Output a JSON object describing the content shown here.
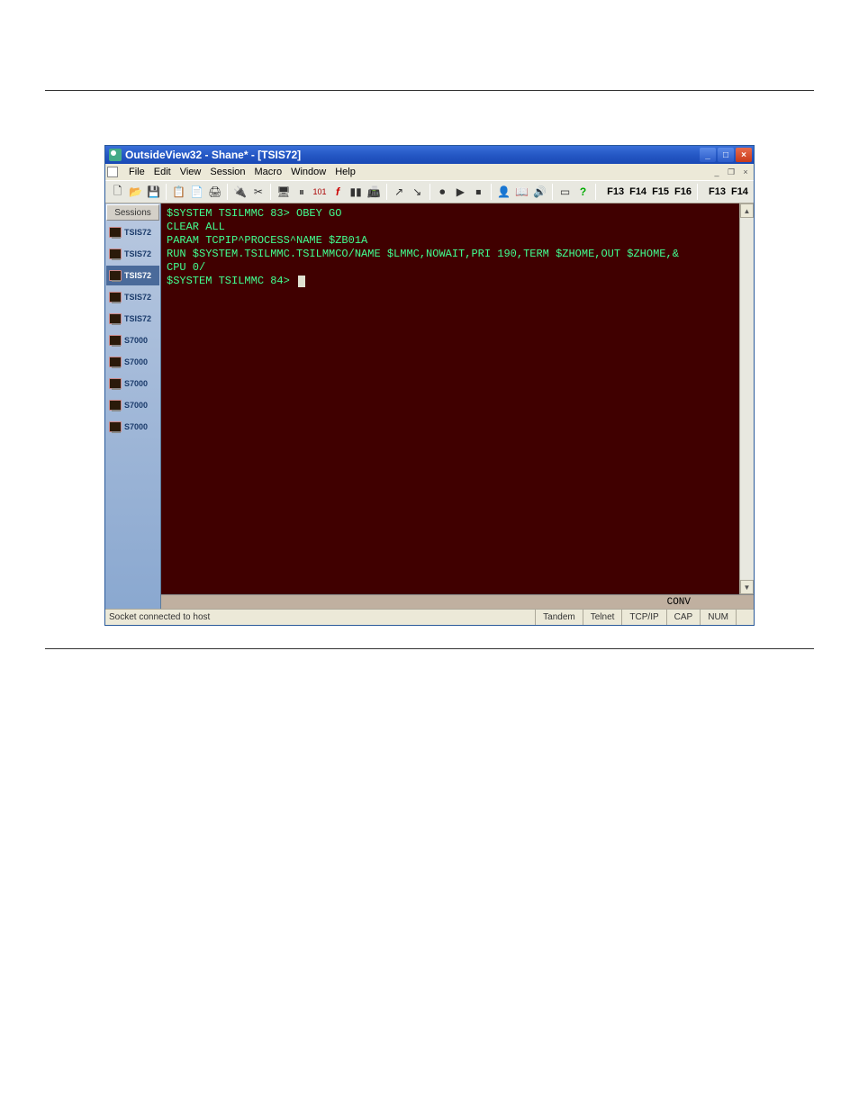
{
  "window": {
    "title": "OutsideView32 - Shane* - [TSIS72]"
  },
  "menu": {
    "file": "File",
    "edit": "Edit",
    "view": "View",
    "session": "Session",
    "macro": "Macro",
    "window": "Window",
    "help": "Help"
  },
  "toolbar": {
    "icons": [
      "new-icon",
      "open-icon",
      "save-icon",
      "copy-icon",
      "paste-icon",
      "print-icon",
      "connect-icon",
      "disconnect-icon",
      "terminal-icon",
      "pause-icon",
      "vars-icon",
      "function-icon",
      "columns-icon",
      "transfer-icon",
      "send-icon",
      "receive-icon",
      "record-icon",
      "play-icon",
      "stop-icon",
      "user-icon",
      "book-icon",
      "sound-icon",
      "window-icon",
      "help-icon"
    ],
    "fkeys_left": [
      "F13",
      "F14",
      "F15",
      "F16"
    ],
    "fkeys_right": [
      "F13",
      "F14"
    ]
  },
  "sessions": {
    "tab_label": "Sessions",
    "items": [
      {
        "label": "TSIS72",
        "active": false
      },
      {
        "label": "TSIS72",
        "active": false
      },
      {
        "label": "TSIS72",
        "active": true
      },
      {
        "label": "TSIS72",
        "active": false
      },
      {
        "label": "TSIS72",
        "active": false
      },
      {
        "label": "S7000",
        "active": false
      },
      {
        "label": "S7000",
        "active": false
      },
      {
        "label": "S7000",
        "active": false
      },
      {
        "label": "S7000",
        "active": false
      },
      {
        "label": "S7000",
        "active": false
      }
    ]
  },
  "terminal": {
    "lines": [
      "$SYSTEM TSILMMC 83> OBEY GO",
      "CLEAR ALL",
      "PARAM TCPIP^PROCESS^NAME $ZB01A",
      "RUN $SYSTEM.TSILMMC.TSILMMCO/NAME $LMMC,NOWAIT,PRI 190,TERM $ZHOME,OUT $ZHOME,&",
      "CPU 0/",
      "",
      "$SYSTEM TSILMMC 84> "
    ],
    "conv": "CONV"
  },
  "status": {
    "message": "Socket connected to host",
    "emu": "Tandem",
    "proto": "Telnet",
    "net": "TCP/IP",
    "cap": "CAP",
    "num": "NUM"
  }
}
